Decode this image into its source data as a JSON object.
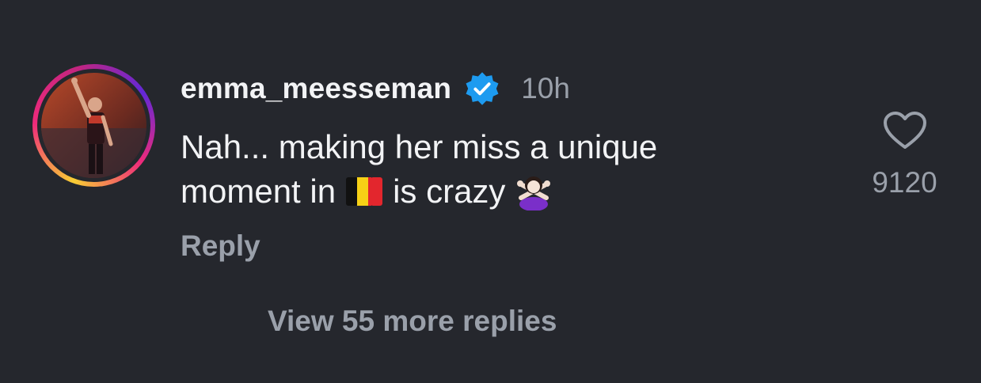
{
  "comment": {
    "username": "emma_meesseman",
    "timestamp": "10h",
    "text_line1": "Nah... making her miss a unique",
    "text_line2_before": "moment in",
    "text_line2_after": "is crazy",
    "reply_label": "Reply",
    "like_count": "9120",
    "flag_icon": "belgium-flag-icon",
    "emoji_icon": "person-gesturing-no-icon"
  },
  "thread": {
    "view_more_label": "View 55 more replies"
  },
  "colors": {
    "background": "#25272d",
    "text_primary": "#f2f3f5",
    "text_secondary": "#9aa0aa",
    "verified_blue": "#1d9bf0"
  }
}
